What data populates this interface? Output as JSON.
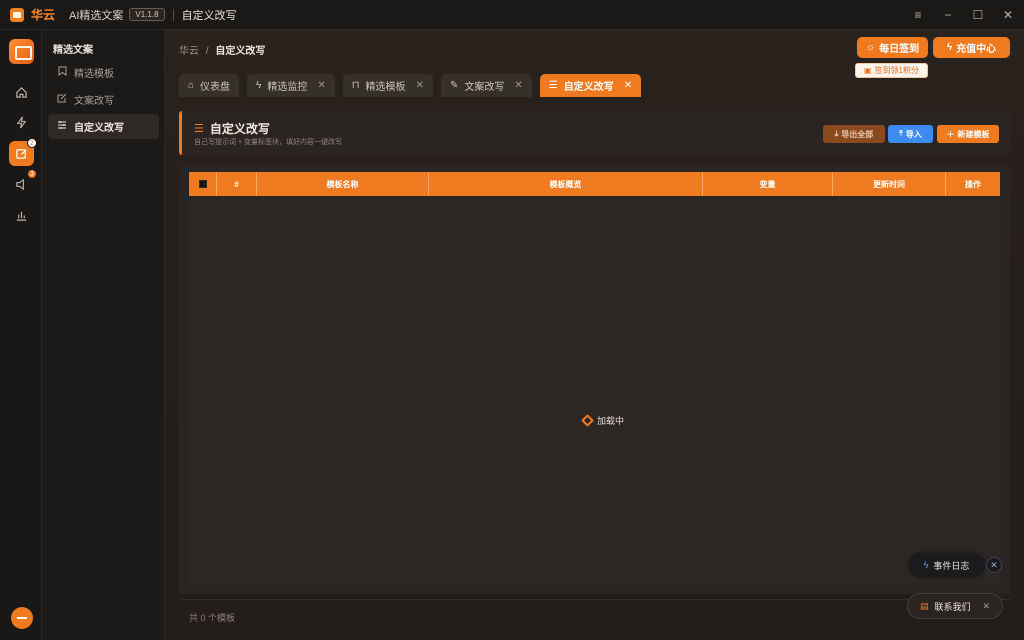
{
  "titlebar": {
    "brand": "华云",
    "app_name": "AI精选文案",
    "version": "V1.1.8",
    "page": "自定义改写",
    "controls": [
      "≡",
      "−",
      "☐",
      "✕"
    ]
  },
  "rail": {
    "badges": {
      "rewrite": "2",
      "broadcast": "3"
    }
  },
  "subnav": {
    "title": "精选文案",
    "items": [
      {
        "label": "精选模板",
        "icon": "bookmark-icon"
      },
      {
        "label": "文案改写",
        "icon": "edit-icon"
      },
      {
        "label": "自定义改写",
        "icon": "sliders-icon",
        "active": true
      }
    ]
  },
  "breadcrumb": {
    "root": "华云",
    "sep": "/",
    "current": "自定义改写"
  },
  "header_actions": {
    "checkin": "每日签到",
    "recharge": "充值中心",
    "checkin_tip": "签到领1积分"
  },
  "tabs": [
    {
      "label": "仪表盘",
      "icon": "home-icon",
      "closable": false
    },
    {
      "label": "精选监控",
      "icon": "bolt-icon",
      "closable": true
    },
    {
      "label": "精选模板",
      "icon": "bookmark-icon",
      "closable": true
    },
    {
      "label": "文案改写",
      "icon": "edit-icon",
      "closable": true
    },
    {
      "label": "自定义改写",
      "icon": "sliders-icon",
      "closable": true,
      "active": true
    }
  ],
  "page_header": {
    "title": "自定义改写",
    "subtitle": "自己写提示词 + 变量标签块，填好内容一键改写",
    "export": "导出全部",
    "import": "导入",
    "create": "新建模板"
  },
  "table": {
    "columns": [
      "#",
      "模板名称",
      "模板概览",
      "变量",
      "更新时间",
      "操作"
    ],
    "loading": "加载中"
  },
  "footer": {
    "count_text": "共 0 个模板"
  },
  "floating": {
    "event_log": "事件日志",
    "contact": "联系我们"
  },
  "colors": {
    "accent": "#f07a1f",
    "bg": "#1f1c1a",
    "import_blue": "#3d8bf0"
  }
}
